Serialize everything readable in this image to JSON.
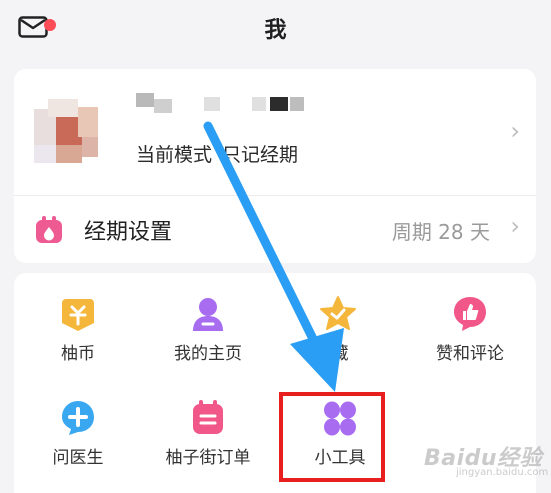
{
  "header": {
    "title": "我",
    "mail_icon": "mail-icon",
    "has_notification_dot": true
  },
  "profile": {
    "mode_label": "当前模式",
    "mode_value": "只记经期",
    "username_blurred": true
  },
  "period_settings": {
    "label": "经期设置",
    "value": "周期 28 天",
    "icon": "calendar-icon"
  },
  "tools": [
    {
      "label": "柚币",
      "icon": "coin-icon",
      "color": "#f5b73b"
    },
    {
      "label": "我的主页",
      "icon": "user-icon",
      "color": "#a86cf0"
    },
    {
      "label": "藏",
      "icon": "star-icon",
      "color": "#f5b73b"
    },
    {
      "label": "赞和评论",
      "icon": "thumbs-up-icon",
      "color": "#f2578a"
    },
    {
      "label": "问医生",
      "icon": "doctor-icon",
      "color": "#3aa8f0"
    },
    {
      "label": "柚子街订单",
      "icon": "order-icon",
      "color": "#f2578a"
    },
    {
      "label": "小工具",
      "icon": "grid-icon",
      "color": "#a86cf0"
    }
  ],
  "annotation": {
    "arrow_color": "#2a9df4",
    "box_color": "#e81f1f"
  },
  "watermark": {
    "main": "Baidu经验",
    "sub": "jingyan.baidu.com"
  }
}
